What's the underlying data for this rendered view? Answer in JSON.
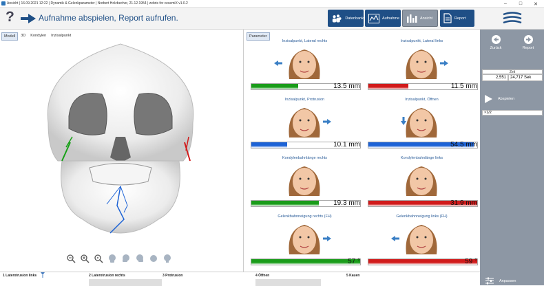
{
  "titlebar": {
    "text": "Ansicht | 16.09.2021 12:22 | Dynamik & Gelenkparameter | Norbert Holzbecher, 21.12.1954 | zebris for cesemiX v1.0.2",
    "minimize": "–",
    "maximize": "□",
    "close": "✕"
  },
  "header": {
    "help": "?",
    "headline": "Aufnahme abspielen, Report aufrufen.",
    "nav": [
      {
        "label": "Datenbank",
        "icon": "people-icon",
        "active": false
      },
      {
        "label": "Aufnahme",
        "icon": "chart-icon",
        "active": false
      },
      {
        "label": "Ansicht",
        "icon": "bars-icon",
        "active": true
      },
      {
        "label": "Report",
        "icon": "document-icon",
        "active": false
      }
    ]
  },
  "view": {
    "tabs": [
      "Modell",
      "3D",
      "Kondylen",
      "Inzisalpunkt"
    ],
    "active_tab": "Modell"
  },
  "params": {
    "tab": "Parameter",
    "cells": [
      {
        "title": "Inzisalpunkt, Lateral rechts",
        "value": "13.5 mm",
        "fill": 0.43,
        "color": "#1a9c1a",
        "arrow": "left"
      },
      {
        "title": "Inzisalpunkt, Lateral links",
        "value": "11.5 mm",
        "fill": 0.37,
        "color": "#d11b1b",
        "arrow": "right"
      },
      {
        "title": "Inzisalpunkt, Protrusion",
        "value": "10.1 mm",
        "fill": 0.33,
        "color": "#1d63d6",
        "arrow": "right"
      },
      {
        "title": "Inzisalpunkt, Öffnen",
        "value": "54.5 mm",
        "fill": 0.97,
        "color": "#1d63d6",
        "arrow": "down"
      },
      {
        "title": "Kondylenbahnlänge rechts",
        "value": "19.3 mm",
        "fill": 0.62,
        "color": "#1a9c1a",
        "arrow": "none"
      },
      {
        "title": "Kondylenbahnlänge links",
        "value": "31.9 mm",
        "fill": 1.0,
        "color": "#d11b1b",
        "arrow": "none"
      },
      {
        "title": "Gelenkbahnneigung rechts (FH)",
        "value": "57 °",
        "fill": 1.0,
        "color": "#1a9c1a",
        "arrow": "right"
      },
      {
        "title": "Gelenkbahnneigung links (FH)",
        "value": "59 °",
        "fill": 1.0,
        "color": "#d11b1b",
        "arrow": "left"
      }
    ]
  },
  "sidebar": {
    "back": "Zurück",
    "report": "Report",
    "time_label": "Zeit",
    "time_current": "2,551",
    "time_total": "24,717 Sek",
    "play": "Abspielen",
    "speed": "×1/2",
    "adjust": "Anpassen"
  },
  "timeline": {
    "segments": [
      "1 Laterotrusion links",
      "2 Laterotrusion rechts",
      "3 Protrusion",
      "4 Öffnen",
      "5 Kauen"
    ]
  },
  "colors": {
    "accent": "#1f4f86",
    "nav_button": "#1f4f86",
    "nav_active": "#8d97a4",
    "sidebar": "#8d97a4",
    "green": "#1a9c1a",
    "red": "#d11b1b",
    "blue": "#1d63d6"
  }
}
